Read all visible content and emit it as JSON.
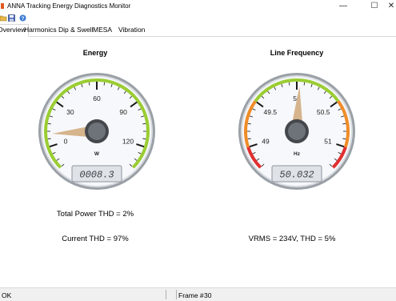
{
  "window": {
    "title": "ANNA Tracking Energy Diagnostics Monitor",
    "minimize_glyph": "—",
    "maximize_glyph": "☐",
    "close_glyph": "✕"
  },
  "toolbar": {
    "icons": [
      "open-icon",
      "save-icon",
      "help-icon"
    ]
  },
  "tabs": [
    {
      "label": "Overview",
      "active": true
    },
    {
      "label": "Harmonics",
      "active": false
    },
    {
      "label": "Dip & Swell",
      "active": false
    },
    {
      "label": "MESA",
      "active": false
    },
    {
      "label": "Vibration",
      "active": false
    }
  ],
  "gauges": {
    "energy": {
      "title": "Energy",
      "unit": "W",
      "min": -15,
      "max": 135,
      "ticks": [
        "0",
        "30",
        "60",
        "90",
        "120"
      ],
      "value": 8.3,
      "display": "0008.3",
      "bands": [
        {
          "from": -15,
          "to": 135,
          "color": "#9acd32"
        }
      ]
    },
    "frequency": {
      "title": "Line Frequency",
      "unit": "Hz",
      "min": 48.75,
      "max": 51.25,
      "ticks": [
        "49",
        "49.5",
        "50",
        "50.5",
        "51"
      ],
      "value": 50.032,
      "display": "50.032",
      "bands": [
        {
          "from": 48.75,
          "to": 49.0,
          "color": "#e03030"
        },
        {
          "from": 49.0,
          "to": 49.5,
          "color": "#f08c28"
        },
        {
          "from": 49.5,
          "to": 50.5,
          "color": "#9acd32"
        },
        {
          "from": 50.5,
          "to": 51.0,
          "color": "#f08c28"
        },
        {
          "from": 51.0,
          "to": 51.25,
          "color": "#e03030"
        }
      ]
    }
  },
  "energy_info": {
    "thd": "Total Power THD = 2%",
    "current": "Current THD = 97%"
  },
  "frequency_info": {
    "vrms": "VRMS = 234V, THD = 5%"
  },
  "status": {
    "left": "OK",
    "frame_label": "Frame #",
    "frame_value": "30"
  }
}
